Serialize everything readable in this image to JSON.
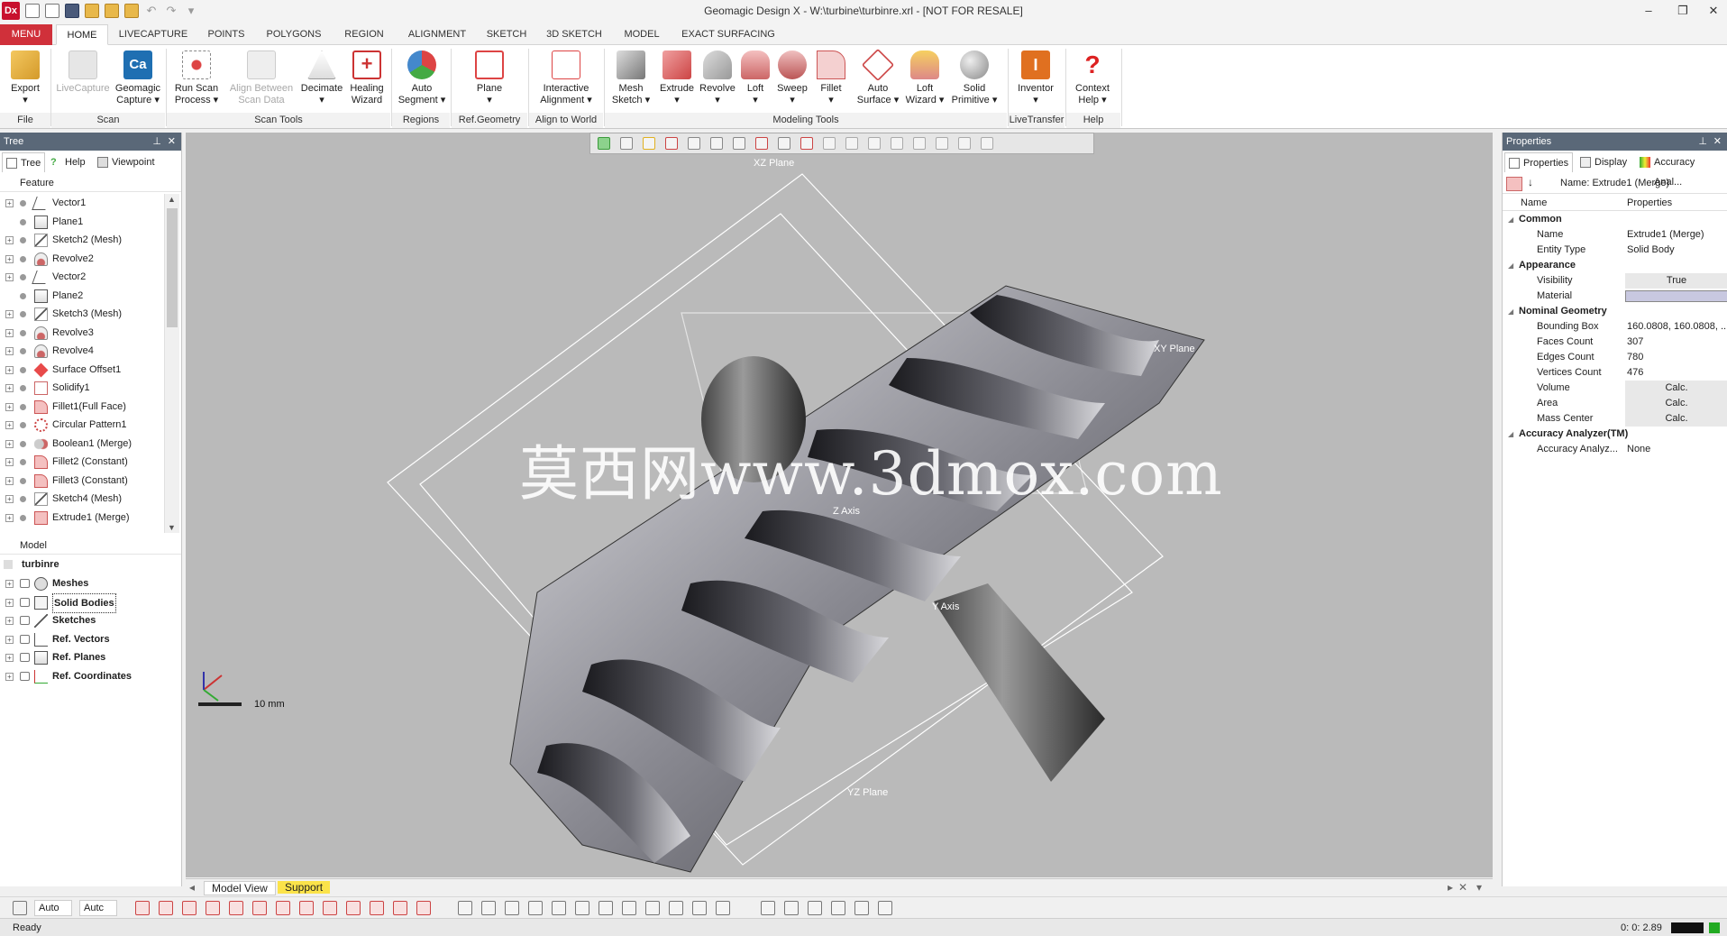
{
  "window": {
    "title": "Geomagic Design X - W:\\turbine\\turbinre.xrl - [NOT FOR RESALE]",
    "logo_text": "Dx",
    "minimize": "–",
    "restore": "❐",
    "close": "✕"
  },
  "menu_label": "MENU",
  "tabs": [
    "HOME",
    "LIVECAPTURE",
    "POINTS",
    "POLYGONS",
    "REGION",
    "ALIGNMENT",
    "SKETCH",
    "3D SKETCH",
    "MODEL",
    "EXACT SURFACING"
  ],
  "active_tab": "HOME",
  "ribbon": {
    "buttons": [
      {
        "label": "Export",
        "sub": "▾"
      },
      {
        "label": "LiveCapture",
        "sub": "",
        "disabled": true
      },
      {
        "label": "Geomagic",
        "sub": "Capture ▾",
        "icon_text": "Ca"
      },
      {
        "label": "Run Scan",
        "sub": "Process ▾"
      },
      {
        "label": "Align Between",
        "sub": "Scan Data",
        "disabled": true
      },
      {
        "label": "Decimate",
        "sub": "▾"
      },
      {
        "label": "Healing",
        "sub": "Wizard"
      },
      {
        "label": "Auto",
        "sub": "Segment ▾"
      },
      {
        "label": "Plane",
        "sub": "▾"
      },
      {
        "label": "Interactive",
        "sub": "Alignment ▾"
      },
      {
        "label": "Mesh",
        "sub": "Sketch ▾"
      },
      {
        "label": "Extrude",
        "sub": "▾"
      },
      {
        "label": "Revolve",
        "sub": "▾"
      },
      {
        "label": "Loft",
        "sub": "▾"
      },
      {
        "label": "Sweep",
        "sub": "▾"
      },
      {
        "label": "Fillet",
        "sub": "▾"
      },
      {
        "label": "Auto",
        "sub": "Surface ▾"
      },
      {
        "label": "Loft",
        "sub": "Wizard ▾"
      },
      {
        "label": "Solid",
        "sub": "Primitive ▾"
      },
      {
        "label": "Inventor",
        "sub": "▾"
      },
      {
        "label": "Context",
        "sub": "Help ▾"
      }
    ],
    "groups": [
      "File",
      "Scan",
      "Scan Tools",
      "Regions",
      "Ref.Geometry",
      "Align to World",
      "Modeling Tools",
      "LiveTransfer",
      "Help"
    ]
  },
  "tree_panel": {
    "title": "Tree",
    "subtabs": [
      "Tree",
      "Help",
      "Viewpoint"
    ],
    "feature_header": "Feature",
    "features": [
      {
        "label": "Vector1",
        "icon": "vector-icon"
      },
      {
        "label": "Plane1",
        "icon": "plane-icon"
      },
      {
        "label": "Sketch2 (Mesh)",
        "icon": "sketch-icon"
      },
      {
        "label": "Revolve2",
        "icon": "revolve-icon"
      },
      {
        "label": "Vector2",
        "icon": "vector-icon"
      },
      {
        "label": "Plane2",
        "icon": "plane-icon"
      },
      {
        "label": "Sketch3 (Mesh)",
        "icon": "sketch-icon"
      },
      {
        "label": "Revolve3",
        "icon": "revolve-icon"
      },
      {
        "label": "Revolve4",
        "icon": "revolve-icon"
      },
      {
        "label": "Surface Offset1",
        "icon": "surface-offset-icon"
      },
      {
        "label": "Solidify1",
        "icon": "solidify-icon"
      },
      {
        "label": "Fillet1(Full Face)",
        "icon": "fillet-icon"
      },
      {
        "label": "Circular Pattern1",
        "icon": "circular-pattern-icon"
      },
      {
        "label": "Boolean1 (Merge)",
        "icon": "boolean-icon"
      },
      {
        "label": "Fillet2 (Constant)",
        "icon": "fillet-icon"
      },
      {
        "label": "Fillet3 (Constant)",
        "icon": "fillet-icon"
      },
      {
        "label": "Sketch4 (Mesh)",
        "icon": "sketch-icon"
      },
      {
        "label": "Extrude1 (Merge)",
        "icon": "extrude-icon"
      }
    ],
    "model_header": "Model",
    "model_root": "turbinre",
    "model_items": [
      "Meshes",
      "Solid Bodies",
      "Sketches",
      "Ref. Vectors",
      "Ref. Planes",
      "Ref. Coordinates"
    ]
  },
  "viewport": {
    "watermark": "莫西网www.3dmox.com",
    "plane_labels": [
      "XZ Plane",
      "XY Plane",
      "YZ Plane",
      "Z Axis",
      "Y Axis"
    ],
    "scale_label": "10 mm",
    "view_tabs": [
      "Model View",
      "Support"
    ]
  },
  "properties_panel": {
    "title": "Properties",
    "subtabs": [
      "Properties",
      "Display",
      "Accuracy Anal..."
    ],
    "name_line": "Name: Extrude1 (Merge)",
    "col_name": "Name",
    "col_props": "Properties",
    "categories": [
      {
        "name": "Common",
        "rows": [
          {
            "name": "Name",
            "value": "Extrude1 (Merge)"
          },
          {
            "name": "Entity Type",
            "value": "Solid Body"
          }
        ]
      },
      {
        "name": "Appearance",
        "rows": [
          {
            "name": "Visibility",
            "value": "True"
          },
          {
            "name": "Material",
            "value": ""
          }
        ]
      },
      {
        "name": "Nominal Geometry",
        "rows": [
          {
            "name": "Bounding Box",
            "value": "160.0808, 160.0808, ..."
          },
          {
            "name": "Faces Count",
            "value": "307"
          },
          {
            "name": "Edges Count",
            "value": "780"
          },
          {
            "name": "Vertices Count",
            "value": "476"
          },
          {
            "name": "Volume",
            "value": "Calc."
          },
          {
            "name": "Area",
            "value": "Calc."
          },
          {
            "name": "Mass Center",
            "value": "Calc."
          }
        ]
      },
      {
        "name": "Accuracy Analyzer(TM)",
        "rows": [
          {
            "name": "Accuracy Analyz...",
            "value": "None"
          }
        ]
      }
    ]
  },
  "bottom_toolbar": {
    "auto1": "Auto",
    "auto2": "Autc"
  },
  "status": {
    "left": "Ready",
    "right": "0: 0: 2.89"
  },
  "colors": {
    "accent_red": "#d0303a",
    "panel_title": "#5a6878",
    "viewport_bg": "#bababa"
  }
}
